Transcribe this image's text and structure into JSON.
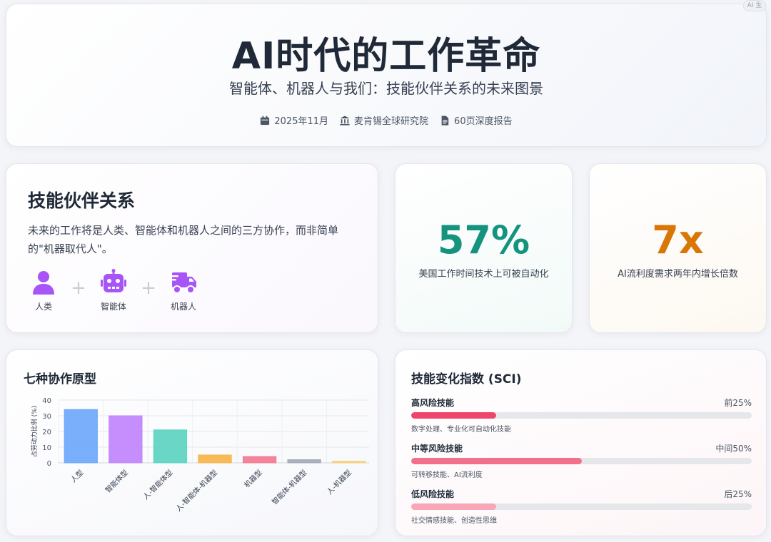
{
  "header": {
    "title": "AI时代的工作革命",
    "subtitle": "智能体、机器人与我们：技能伙伴关系的未来图景",
    "meta": [
      {
        "icon": "calendar-icon",
        "text": "2025年11月"
      },
      {
        "icon": "institution-icon",
        "text": "麦肯锡全球研究院"
      },
      {
        "icon": "document-icon",
        "text": "60页深度报告"
      }
    ],
    "corner_badge": "AI 生"
  },
  "partnership": {
    "title": "技能伙伴关系",
    "description": "未来的工作将是人类、智能体和机器人之间的三方协作，而非简单的\"机器取代人\"。",
    "items": [
      {
        "icon": "person-icon",
        "label": "人类"
      },
      {
        "icon": "robot-icon",
        "label": "智能体"
      },
      {
        "icon": "truck-icon",
        "label": "机器人"
      }
    ],
    "icon_color": "#a855f7"
  },
  "stats": [
    {
      "value": "57%",
      "caption": "美国工作时间技术上可被自动化",
      "color": "#14937f"
    },
    {
      "value": "7x",
      "caption": "AI流利度需求两年内增长倍数",
      "color": "#d97706"
    }
  ],
  "chart_card": {
    "title": "七种协作原型"
  },
  "chart_data": {
    "type": "bar",
    "categories": [
      "人型",
      "智能体型",
      "人-智能体型",
      "人-智能体-机器型",
      "机器型",
      "智能体-机器型",
      "人-机器型"
    ],
    "values": [
      34,
      30,
      21,
      5,
      4,
      2,
      1
    ],
    "colors": [
      "#6ea8fb",
      "#c084fc",
      "#5dd3c0",
      "#f5b54a",
      "#f27a93",
      "#a3a8b3",
      "#f3d07a"
    ],
    "ylabel": "占劳动力比例 (%)",
    "ylim": [
      0,
      40
    ],
    "yticks": [
      0,
      10,
      20,
      30,
      40
    ],
    "grid": true
  },
  "sci": {
    "title": "技能变化指数 (SCI)",
    "items": [
      {
        "name": "高风险技能",
        "position": "前25%",
        "note": "数字处理、专业化可自动化技能",
        "fill": 0.25,
        "color": "#f0456a"
      },
      {
        "name": "中等风险技能",
        "position": "中间50%",
        "note": "可转移技能、AI流利度",
        "fill": 0.5,
        "color": "#f2708a"
      },
      {
        "name": "低风险技能",
        "position": "后25%",
        "note": "社交情感技能、创造性思维",
        "fill": 0.25,
        "color": "#f7a7b6"
      }
    ]
  }
}
